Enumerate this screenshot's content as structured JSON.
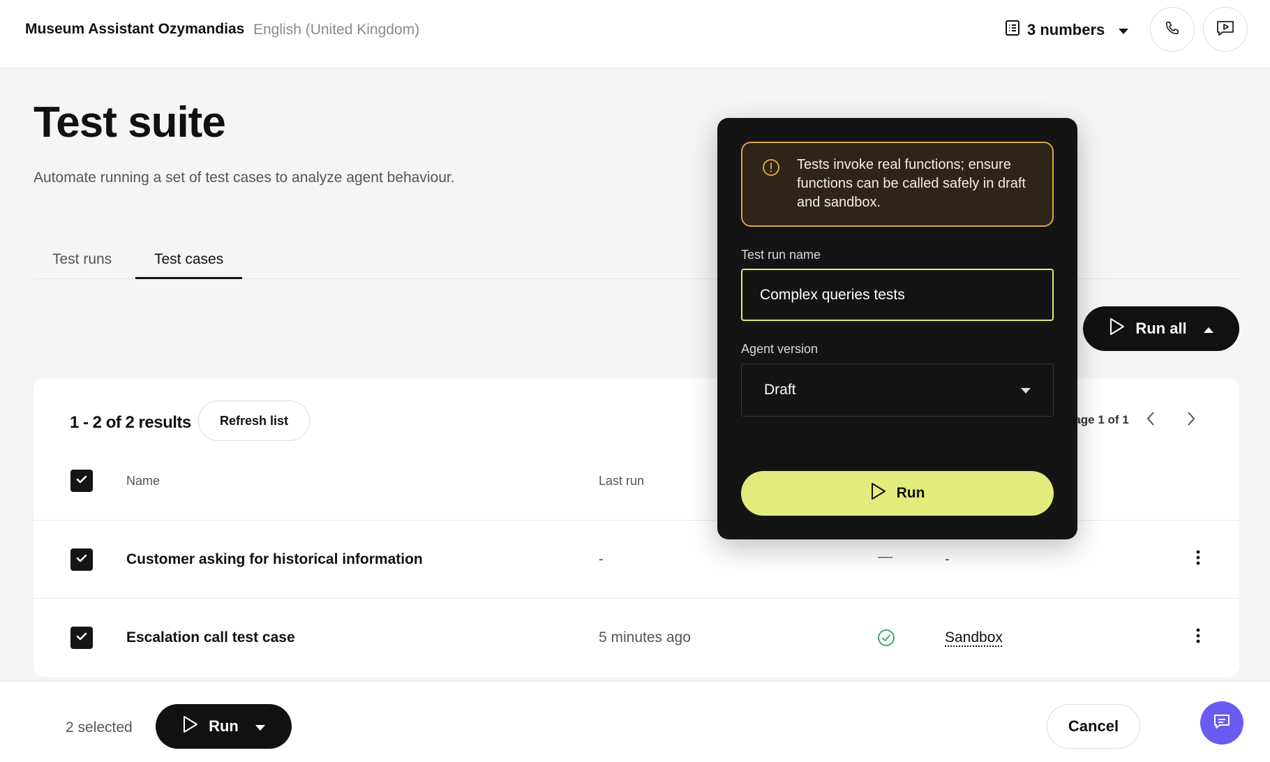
{
  "header": {
    "agent_name": "Museum Assistant Ozymandias",
    "language": "English (United Kingdom)",
    "numbers_label": "3 numbers"
  },
  "page": {
    "title": "Test suite",
    "subtitle": "Automate running a set of test cases to analyze agent behaviour."
  },
  "tabs": [
    {
      "label": "Test runs",
      "active": false
    },
    {
      "label": "Test cases",
      "active": true
    }
  ],
  "run_all_label": "Run all",
  "table": {
    "results_label": "1 - 2 of 2 results",
    "refresh_label": "Refresh list",
    "page_label": "Page 1 of 1",
    "columns": {
      "name": "Name",
      "last_run": "Last run"
    },
    "rows": [
      {
        "name": "Customer asking for historical information",
        "last_run": "-",
        "status": "—",
        "environment": "-"
      },
      {
        "name": "Escalation call test case",
        "last_run": "5 minutes ago",
        "status": "passed",
        "environment": "Sandbox"
      }
    ]
  },
  "bottom_bar": {
    "selected_label": "2 selected",
    "run_label": "Run",
    "cancel_label": "Cancel"
  },
  "popover": {
    "warning": "Tests invoke real functions; ensure functions can be called safely in draft and sandbox.",
    "test_run_name_label": "Test run name",
    "test_run_name_value": "Complex queries tests",
    "agent_version_label": "Agent version",
    "agent_version_value": "Draft",
    "run_label": "Run"
  },
  "colors": {
    "accent_lime": "#e1ec7d",
    "warning_border": "#d7a748",
    "success_green": "#3fae6a",
    "chat_fab": "#6a5cf0",
    "dark": "#141414"
  }
}
